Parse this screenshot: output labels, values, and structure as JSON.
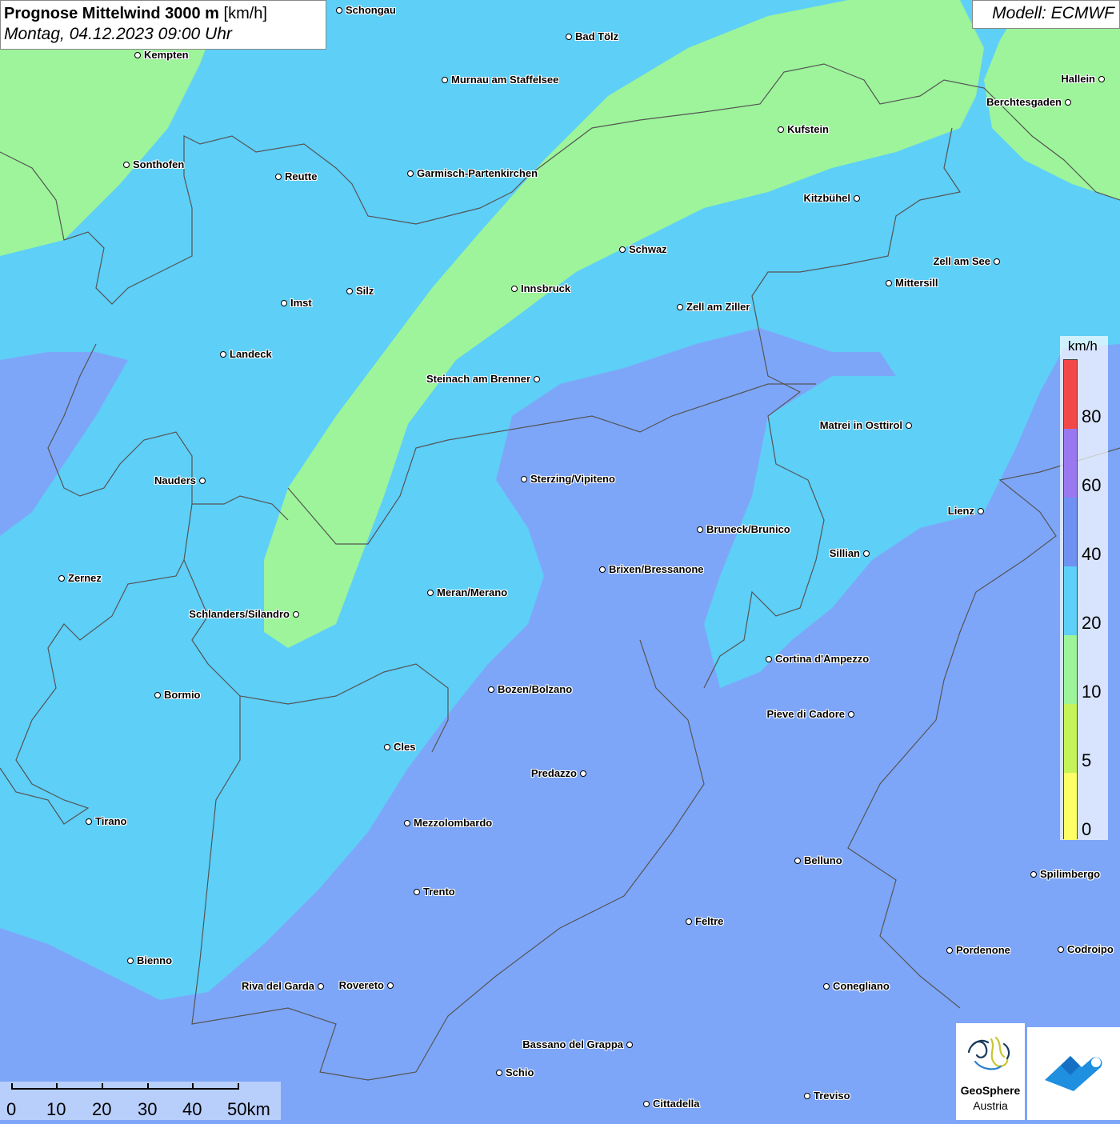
{
  "title": {
    "main_bold": "Prognose Mittelwind 3000 m",
    "unit": " [km/h]",
    "subtitle": "Montag, 04.12.2023 09:00 Uhr"
  },
  "model_label": "Modell: ECMWF",
  "colors": {
    "band_0_5": "#ffff66",
    "band_5_10": "#c6f25a",
    "band_10_20": "#9df49a",
    "band_20_40": "#5ecff7",
    "band_40_60": "#7ea6f8",
    "band_60_80": "#9a78f0",
    "band_80_plus": "#f24848"
  },
  "legend": {
    "unit": "km/h",
    "ticks": [
      "80",
      "60",
      "40",
      "20",
      "10",
      "5",
      "0"
    ]
  },
  "scale_bar": {
    "labels": [
      "0",
      "10",
      "20",
      "30",
      "40",
      "50km"
    ]
  },
  "cities": [
    {
      "name": "Schongau",
      "side": "r"
    },
    {
      "name": "Bad Tölz",
      "side": "r"
    },
    {
      "name": "Kempten",
      "side": "r"
    },
    {
      "name": "Murnau am Staffelsee",
      "side": "r"
    },
    {
      "name": "Hallein",
      "side": "l"
    },
    {
      "name": "Berchtesgaden",
      "side": "l"
    },
    {
      "name": "Kufstein",
      "side": "r"
    },
    {
      "name": "Sonthofen",
      "side": "r"
    },
    {
      "name": "Reutte",
      "side": "r"
    },
    {
      "name": "Garmisch-Partenkirchen",
      "side": "r"
    },
    {
      "name": "Kitzbühel",
      "side": "l"
    },
    {
      "name": "Schwaz",
      "side": "r"
    },
    {
      "name": "Zell am See",
      "side": "l"
    },
    {
      "name": "Mittersill",
      "side": "r"
    },
    {
      "name": "Innsbruck",
      "side": "r"
    },
    {
      "name": "Silz",
      "side": "r"
    },
    {
      "name": "Imst",
      "side": "r"
    },
    {
      "name": "Zell am Ziller",
      "side": "r"
    },
    {
      "name": "Landeck",
      "side": "r"
    },
    {
      "name": "Steinach am Brenner",
      "side": "l"
    },
    {
      "name": "Matrei in Osttirol",
      "side": "l"
    },
    {
      "name": "Nauders",
      "side": "l"
    },
    {
      "name": "Sterzing/Vipiteno",
      "side": "r"
    },
    {
      "name": "Lienz",
      "side": "l"
    },
    {
      "name": "Bruneck/Brunico",
      "side": "r"
    },
    {
      "name": "Sillian",
      "side": "l"
    },
    {
      "name": "Zernez",
      "side": "r"
    },
    {
      "name": "Brixen/Bressanone",
      "side": "r"
    },
    {
      "name": "Meran/Merano",
      "side": "r"
    },
    {
      "name": "Schlanders/Silandro",
      "side": "l"
    },
    {
      "name": "Cortina d'Ampezzo",
      "side": "r"
    },
    {
      "name": "Bozen/Bolzano",
      "side": "r"
    },
    {
      "name": "Bormio",
      "side": "r"
    },
    {
      "name": "Pieve di Cadore",
      "side": "l"
    },
    {
      "name": "Cles",
      "side": "r"
    },
    {
      "name": "Predazzo",
      "side": "l"
    },
    {
      "name": "Tirano",
      "side": "r"
    },
    {
      "name": "Mezzolombardo",
      "side": "r"
    },
    {
      "name": "Belluno",
      "side": "r"
    },
    {
      "name": "Spilimbergo",
      "side": "r"
    },
    {
      "name": "Trento",
      "side": "r"
    },
    {
      "name": "Feltre",
      "side": "r"
    },
    {
      "name": "Pordenone",
      "side": "r"
    },
    {
      "name": "Codroipo",
      "side": "r"
    },
    {
      "name": "Bienno",
      "side": "r"
    },
    {
      "name": "Riva del Garda",
      "side": "l"
    },
    {
      "name": "Rovereto",
      "side": "l"
    },
    {
      "name": "Conegliano",
      "side": "r"
    },
    {
      "name": "Bassano del Grappa",
      "side": "l"
    },
    {
      "name": "Schio",
      "side": "r"
    },
    {
      "name": "Treviso",
      "side": "r"
    },
    {
      "name": "Cittadella",
      "side": "r"
    }
  ],
  "logos": {
    "geosphere_line1": "GeoSphere",
    "geosphere_line2": "Austria"
  }
}
